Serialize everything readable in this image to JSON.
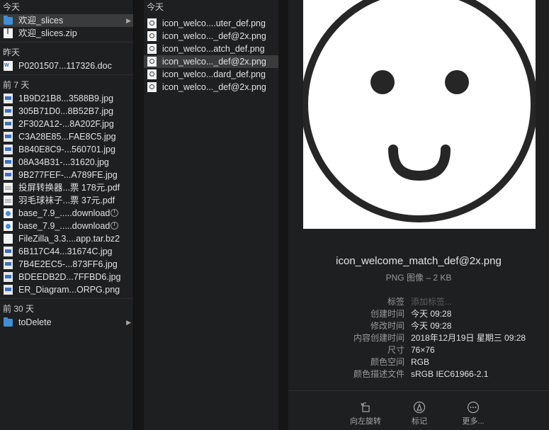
{
  "col1": {
    "sections": [
      {
        "title": "今天",
        "items": [
          {
            "label": "欢迎_slices",
            "icon": "folder-icon",
            "selected": true,
            "chevron": "▶"
          },
          {
            "label": "欢迎_slices.zip",
            "icon": "zip-file-icon"
          }
        ]
      },
      {
        "title": "昨天",
        "items": [
          {
            "label": "P0201507...117326.doc",
            "icon": "word-doc-icon"
          }
        ]
      },
      {
        "title": "前 7 天",
        "items": [
          {
            "label": "1B9D21B8...3588B9.jpg",
            "icon": "image-file-icon"
          },
          {
            "label": "305B71D0...8B52B7.jpg",
            "icon": "image-file-icon"
          },
          {
            "label": "2F302A12-...8A202F.jpg",
            "icon": "image-file-icon"
          },
          {
            "label": "C3A28E85...FAE8C5.jpg",
            "icon": "image-file-icon"
          },
          {
            "label": "B840E8C9-...560701.jpg",
            "icon": "image-file-icon"
          },
          {
            "label": "08A34B31-...31620.jpg",
            "icon": "image-file-icon"
          },
          {
            "label": "9B277FEF-...A789FE.jpg",
            "icon": "image-file-icon"
          },
          {
            "label": "投屏转换器...票 178元.pdf",
            "icon": "pdf-file-icon"
          },
          {
            "label": "羽毛球袜子...票 37元.pdf",
            "icon": "pdf-file-icon"
          },
          {
            "label": "base_7.9_.....download",
            "icon": "download-file-icon",
            "progress": true
          },
          {
            "label": "base_7.9_.....download",
            "icon": "download-file-icon",
            "progress": true
          },
          {
            "label": "FileZilla_3.3....app.tar.bz2",
            "icon": "archive-file-icon"
          },
          {
            "label": "6B117C44...31674C.jpg",
            "icon": "image-file-icon"
          },
          {
            "label": "7B4E2EC5-...873FF6.jpg",
            "icon": "image-file-icon"
          },
          {
            "label": "BDEEDB2D...7FFBD6.jpg",
            "icon": "image-file-icon"
          },
          {
            "label": "ER_Diagram...ORPG.png",
            "icon": "image-file-icon"
          }
        ]
      },
      {
        "title": "前 30 天",
        "items": [
          {
            "label": "toDelete",
            "icon": "folder-icon",
            "chevron": "▶"
          }
        ]
      }
    ]
  },
  "col2": {
    "section": "今天",
    "items": [
      {
        "label": "icon_welco....uter_def.png"
      },
      {
        "label": "icon_welco..._def@2x.png"
      },
      {
        "label": "icon_welco...atch_def.png"
      },
      {
        "label": "icon_welco..._def@2x.png",
        "selected": true
      },
      {
        "label": "icon_welco...dard_def.png"
      },
      {
        "label": "icon_welco..._def@2x.png"
      }
    ]
  },
  "preview": {
    "filename": "icon_welcome_match_def@2x.png",
    "kind": "PNG 图像 – 2 KB",
    "meta": [
      {
        "k": "标签",
        "v": "添加标签...",
        "placeholder": true
      },
      {
        "k": "创建时间",
        "v": "今天 09:28"
      },
      {
        "k": "修改时间",
        "v": "今天 09:28"
      },
      {
        "k": "内容创建时间",
        "v": "2018年12月19日 星期三 09:28"
      },
      {
        "k": "尺寸",
        "v": "76×76"
      },
      {
        "k": "颜色空间",
        "v": "RGB"
      },
      {
        "k": "颜色描述文件",
        "v": "sRGB IEC61966-2.1"
      }
    ],
    "actions": [
      {
        "label": "向左旋转",
        "icon": "rotate-left-icon"
      },
      {
        "label": "标记",
        "icon": "markup-icon"
      },
      {
        "label": "更多...",
        "icon": "more-icon"
      }
    ]
  }
}
